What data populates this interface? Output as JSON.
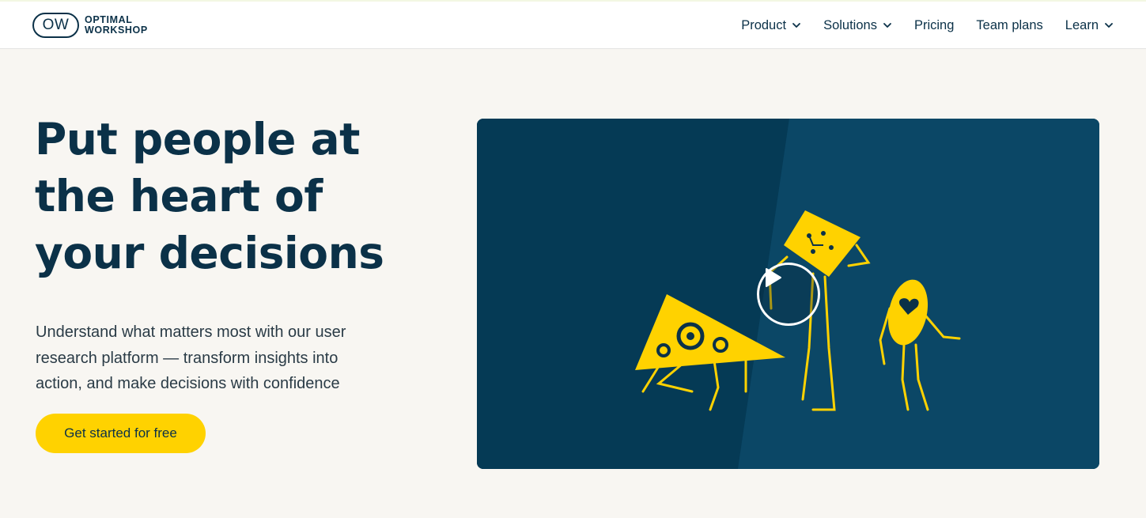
{
  "brand": {
    "mark": "OW",
    "line1": "OPTIMAL",
    "line2": "WORKSHOP"
  },
  "nav": {
    "items": [
      {
        "label": "Product",
        "has_dropdown": true
      },
      {
        "label": "Solutions",
        "has_dropdown": true
      },
      {
        "label": "Pricing",
        "has_dropdown": false
      },
      {
        "label": "Team plans",
        "has_dropdown": false
      },
      {
        "label": "Learn",
        "has_dropdown": true
      }
    ]
  },
  "hero": {
    "title_lines": [
      "Put people at",
      "the heart of",
      "your decisions"
    ],
    "subtitle_lines": [
      "Understand what matters most with our user",
      "research platform — transform insights into",
      "action, and make decisions with confidence"
    ],
    "cta_label": "Get started for free"
  },
  "video": {
    "play_icon": "play-icon",
    "accent_color": "#ffd200",
    "background_color": "#08405e"
  },
  "colors": {
    "brand_navy": "#0b3148",
    "cta_yellow": "#ffd200",
    "page_bg": "#f8f6f2"
  }
}
